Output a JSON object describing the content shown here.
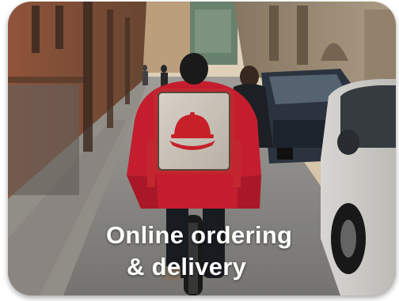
{
  "caption": {
    "line1": "Online ordering",
    "line2": "& delivery"
  },
  "colors": {
    "backpack_red": "#cf2a33",
    "jacket_red": "#d11f31",
    "text": "#ffffff"
  },
  "scene_objects": [
    "narrow-street",
    "courier-on-bicycle",
    "delivery-backpack",
    "cloche-icon",
    "parked-cars",
    "pedestrians",
    "buildings"
  ]
}
